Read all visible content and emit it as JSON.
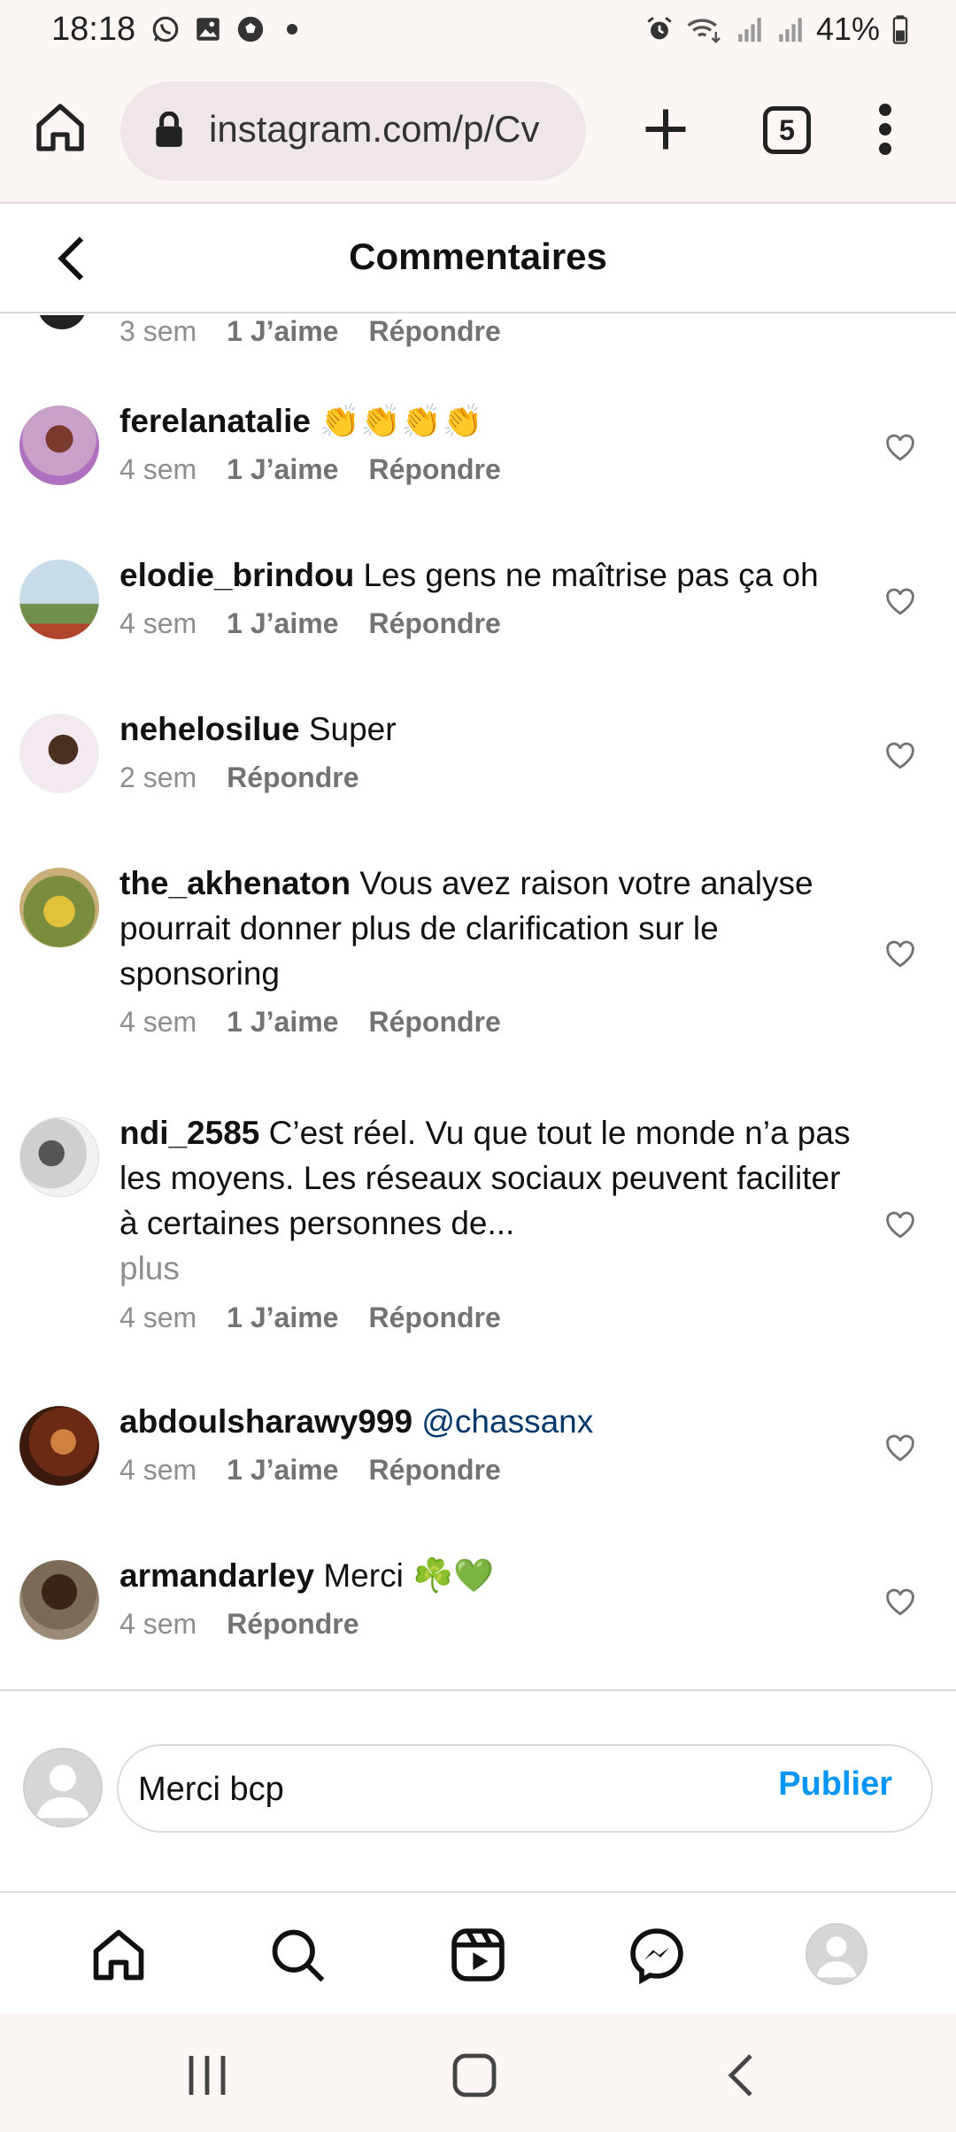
{
  "status_bar": {
    "time": "18:18",
    "battery": "41%",
    "notification_icons": [
      "whatsapp-icon",
      "gallery-icon",
      "soccer-icon",
      "dot-icon"
    ],
    "system_icons": [
      "alarm-icon",
      "wifi-icon",
      "signal-icon",
      "signal-icon",
      "battery-icon"
    ]
  },
  "browser": {
    "url": "instagram.com/p/Cv",
    "tab_count": "5"
  },
  "header": {
    "title": "Commentaires"
  },
  "comments": {
    "partial": {
      "time": "3 sem",
      "likes": "1 J’aime",
      "reply": "Répondre"
    },
    "items": [
      {
        "username": "ferelanatalie",
        "text": "👏👏👏👏",
        "time": "4 sem",
        "likes": "1 J’aime",
        "reply": "Répondre"
      },
      {
        "username": "elodie_brindou",
        "text": "Les gens ne maîtrise pas ça oh",
        "time": "4 sem",
        "likes": "1 J’aime",
        "reply": "Répondre"
      },
      {
        "username": "nehelosilue",
        "text": "Super",
        "time": "2 sem",
        "likes": "",
        "reply": "Répondre"
      },
      {
        "username": "the_akhenaton",
        "text": "Vous avez raison votre analyse pourrait donner plus de clarification sur le sponsoring",
        "time": "4 sem",
        "likes": "1 J’aime",
        "reply": "Répondre"
      },
      {
        "username": "ndi_2585",
        "text": "C’est réel. Vu que tout le monde n’a pas les moyens. Les réseaux sociaux peuvent faciliter à certaines personnes de...",
        "more": "plus",
        "time": "4 sem",
        "likes": "1 J’aime",
        "reply": "Répondre"
      },
      {
        "username": "abdoulsharawy999",
        "mention": "@chassanx",
        "time": "4 sem",
        "likes": "1 J’aime",
        "reply": "Répondre"
      },
      {
        "username": "armandarley",
        "text": "Merci ☘️💚",
        "time": "4 sem",
        "likes": "",
        "reply": "Répondre"
      }
    ]
  },
  "composer": {
    "value": "Merci bcp",
    "publish_label": "Publier"
  },
  "bottom_nav": [
    "home-icon",
    "search-icon",
    "reels-icon",
    "messenger-icon",
    "profile-avatar"
  ],
  "colors": {
    "accent": "#0095f6",
    "mention": "#00376b",
    "muted": "#8e8e8e"
  }
}
